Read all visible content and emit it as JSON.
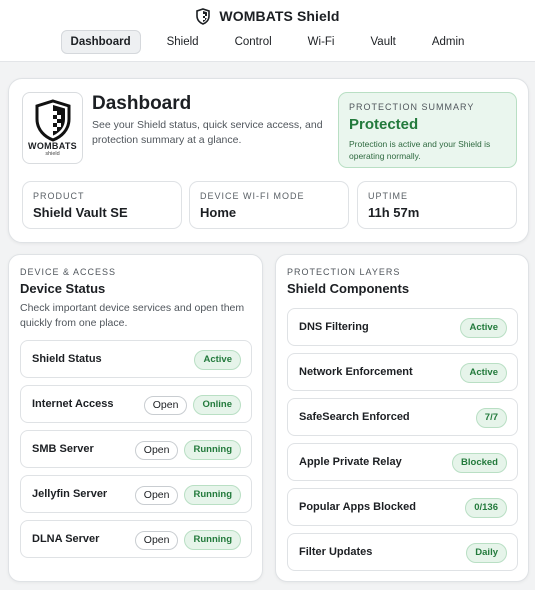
{
  "app": {
    "title": "WOMBATS Shield",
    "icon": "shield-icon"
  },
  "nav": [
    {
      "label": "Dashboard",
      "active": true
    },
    {
      "label": "Shield",
      "active": false
    },
    {
      "label": "Control",
      "active": false
    },
    {
      "label": "Wi-Fi",
      "active": false
    },
    {
      "label": "Vault",
      "active": false
    },
    {
      "label": "Admin",
      "active": false
    }
  ],
  "hero": {
    "logo_word": "WOMBATS",
    "logo_sub": "shield",
    "title": "Dashboard",
    "description": "See your Shield status, quick service access, and protection summary at a glance.",
    "summary": {
      "label": "PROTECTION SUMMARY",
      "value": "Protected",
      "description": "Protection is active and your Shield is operating normally."
    },
    "stats": [
      {
        "label": "PRODUCT",
        "value": "Shield Vault SE"
      },
      {
        "label": "DEVICE WI-FI MODE",
        "value": "Home"
      },
      {
        "label": "UPTIME",
        "value": "11h 57m"
      }
    ]
  },
  "device_panel": {
    "label": "DEVICE & ACCESS",
    "title": "Device Status",
    "description": "Check important device services and open them quickly from one place.",
    "rows": [
      {
        "label": "Shield Status",
        "open": "",
        "status": "Active"
      },
      {
        "label": "Internet Access",
        "open": "Open",
        "status": "Online"
      },
      {
        "label": "SMB Server",
        "open": "Open",
        "status": "Running"
      },
      {
        "label": "Jellyfin Server",
        "open": "Open",
        "status": "Running"
      },
      {
        "label": "DLNA Server",
        "open": "Open",
        "status": "Running"
      }
    ]
  },
  "layers_panel": {
    "label": "PROTECTION LAYERS",
    "title": "Shield Components",
    "rows": [
      {
        "label": "DNS Filtering",
        "status": "Active"
      },
      {
        "label": "Network Enforcement",
        "status": "Active"
      },
      {
        "label": "SafeSearch Enforced",
        "status": "7/7"
      },
      {
        "label": "Apple Private Relay",
        "status": "Blocked"
      },
      {
        "label": "Popular Apps Blocked",
        "status": "0/136"
      },
      {
        "label": "Filter Updates",
        "status": "Daily"
      }
    ]
  },
  "colors": {
    "accent_green": "#237a3c",
    "badge_bg": "#e6f4ea",
    "summary_bg": "#eaf6ee"
  }
}
